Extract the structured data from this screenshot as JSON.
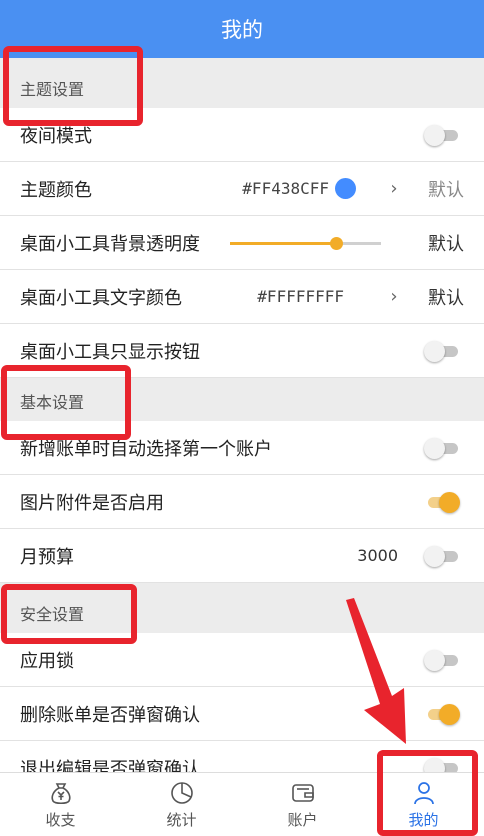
{
  "header": {
    "title": "我的"
  },
  "sections": {
    "theme": {
      "title": "主题设置",
      "night_mode": {
        "label": "夜间模式",
        "enabled": false
      },
      "theme_color": {
        "label": "主题颜色",
        "value": "#FF438CFF",
        "swatch": "#438CFF",
        "default_label": "默认"
      },
      "widget_bg_opacity": {
        "label": "桌面小工具背景透明度",
        "level": 0.7,
        "default_label": "默认"
      },
      "widget_text_color": {
        "label": "桌面小工具文字颜色",
        "value": "#FFFFFFFF",
        "default_label": "默认"
      },
      "widget_buttons_only": {
        "label": "桌面小工具只显示按钮",
        "enabled": false
      }
    },
    "basic": {
      "title": "基本设置",
      "auto_first_account": {
        "label": "新增账单时自动选择第一个账户",
        "enabled": false
      },
      "image_attachment": {
        "label": "图片附件是否启用",
        "enabled": true
      },
      "monthly_budget": {
        "label": "月预算",
        "value": "3000",
        "enabled": false
      }
    },
    "security": {
      "title": "安全设置",
      "app_lock": {
        "label": "应用锁",
        "enabled": false
      },
      "delete_confirm": {
        "label": "删除账单是否弹窗确认",
        "enabled": true
      },
      "exit_edit_confirm": {
        "label": "退出编辑是否弹窗确认",
        "enabled": false
      }
    }
  },
  "tabs": {
    "income": "收支",
    "stats": "统计",
    "account": "账户",
    "mine": "我的"
  },
  "colors": {
    "accent": "#4A90F2",
    "toggle_on": "#F2AC28",
    "highlight": "#E8242D"
  }
}
